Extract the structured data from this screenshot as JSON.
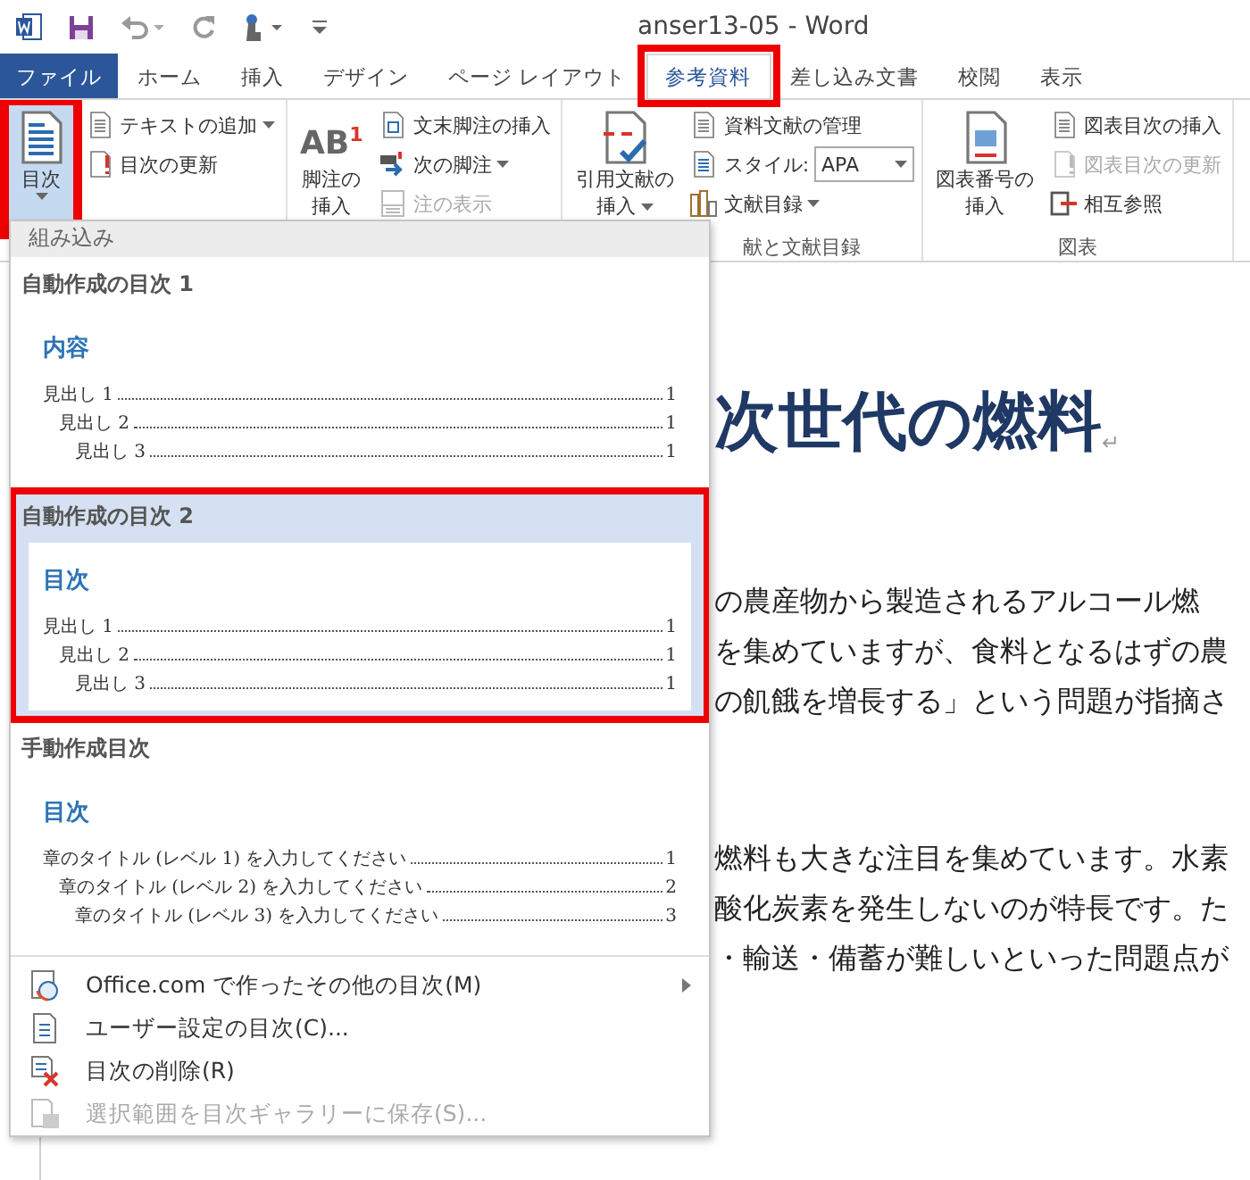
{
  "window": {
    "title": "anser13-05 - Word"
  },
  "tabs": [
    {
      "label": "ファイル",
      "kind": "file",
      "selected": false,
      "highlighted": false
    },
    {
      "label": "ホーム",
      "kind": "tab",
      "selected": false,
      "highlighted": false
    },
    {
      "label": "挿入",
      "kind": "tab",
      "selected": false,
      "highlighted": false
    },
    {
      "label": "デザイン",
      "kind": "tab",
      "selected": false,
      "highlighted": false
    },
    {
      "label": "ページ レイアウト",
      "kind": "tab",
      "selected": false,
      "highlighted": false
    },
    {
      "label": "参考資料",
      "kind": "tab",
      "selected": true,
      "highlighted": true
    },
    {
      "label": "差し込み文書",
      "kind": "tab",
      "selected": false,
      "highlighted": false
    },
    {
      "label": "校閲",
      "kind": "tab",
      "selected": false,
      "highlighted": false
    },
    {
      "label": "表示",
      "kind": "tab",
      "selected": false,
      "highlighted": false
    }
  ],
  "ribbon": {
    "groups": [
      {
        "items": [
          {
            "kind": "large",
            "label_lines": [
              "目次"
            ],
            "dropdown": true,
            "pressed": true,
            "highlighted": true
          },
          {
            "kind": "small",
            "label": "テキストの追加",
            "dropdown": true,
            "disabled": false
          },
          {
            "kind": "small",
            "label": "目次の更新",
            "dropdown": false,
            "disabled": false
          }
        ]
      },
      {
        "items": [
          {
            "kind": "large",
            "glyph": "AB$^{1}$",
            "label_lines": [
              "脚注の",
              "挿入"
            ],
            "dropdown": false,
            "pressed": false,
            "highlighted": false
          },
          {
            "kind": "small",
            "label": "文末脚注の挿入",
            "dropdown": false,
            "disabled": false
          },
          {
            "kind": "small",
            "label": "次の脚注",
            "dropdown": true,
            "disabled": false
          },
          {
            "kind": "small",
            "label": "注の表示",
            "dropdown": false,
            "disabled": true
          }
        ]
      },
      {
        "label": "献と文献目録",
        "items": [
          {
            "kind": "large",
            "label_lines": [
              "引用文献の",
              "挿入"
            ],
            "dropdown": true,
            "pressed": false,
            "highlighted": false
          },
          {
            "kind": "small",
            "label": "資料文献の管理",
            "dropdown": false,
            "disabled": false
          },
          {
            "kind": "combo",
            "label": "スタイル:",
            "value": "APA"
          },
          {
            "kind": "small",
            "label": "文献目録",
            "dropdown": true,
            "disabled": false
          }
        ]
      },
      {
        "label": "図表",
        "items": [
          {
            "kind": "large",
            "label_lines": [
              "図表番号の",
              "挿入"
            ],
            "dropdown": false,
            "pressed": false,
            "highlighted": false
          },
          {
            "kind": "small",
            "label": "図表目次の挿入",
            "dropdown": false,
            "disabled": false
          },
          {
            "kind": "small",
            "label": "図表目次の更新",
            "dropdown": false,
            "disabled": true
          },
          {
            "kind": "small",
            "label": "相互参照",
            "dropdown": false,
            "disabled": false
          }
        ]
      }
    ]
  },
  "document": {
    "heading": "次世代の燃料",
    "paragraph_mark": "↵",
    "paragraphs": [
      [
        "の農産物から製造されるアルコール燃",
        "を集めていますが、食料となるはずの農",
        "の飢餓を増長する」という問題が指摘さ"
      ],
      [
        "燃料も大きな注目を集めています。水素",
        "酸化炭素を発生しないのが特長です。た",
        "・輸送・備蓄が難しいといった問題点が"
      ]
    ]
  },
  "menu": {
    "section": "組み込み",
    "gallery": [
      {
        "label": "自動作成の目次 1",
        "selected": false,
        "highlighted": false,
        "preview": {
          "title": "内容",
          "entries": [
            {
              "text": "見出し 1",
              "page": "1",
              "children": [
                {
                  "text": "見出し 2",
                  "page": "1",
                  "children": [
                    {
                      "text": "見出し 3",
                      "page": "1"
                    }
                  ]
                }
              ]
            }
          ]
        }
      },
      {
        "label": "自動作成の目次 2",
        "selected": true,
        "highlighted": true,
        "preview": {
          "title": "目次",
          "entries": [
            {
              "text": "見出し 1",
              "page": "1",
              "children": [
                {
                  "text": "見出し 2",
                  "page": "1",
                  "children": [
                    {
                      "text": "見出し 3",
                      "page": "1"
                    }
                  ]
                }
              ]
            }
          ]
        }
      },
      {
        "label": "手動作成目次",
        "selected": false,
        "highlighted": false,
        "preview": {
          "title": "目次",
          "entries": [
            {
              "text": "章のタイトル (レベル 1) を入力してください",
              "page": "1",
              "children": [
                {
                  "text": "章のタイトル (レベル 2) を入力してください",
                  "page": "2",
                  "children": [
                    {
                      "text": "章のタイトル (レベル 3) を入力してください",
                      "page": "3"
                    }
                  ]
                }
              ]
            }
          ]
        }
      }
    ],
    "commands": [
      {
        "label": "Office.com で作ったその他の目次(M)",
        "submenu": true,
        "disabled": false
      },
      {
        "label": "ユーザー設定の目次(C)...",
        "submenu": false,
        "disabled": false
      },
      {
        "label": "目次の削除(R)",
        "submenu": false,
        "disabled": false
      },
      {
        "label": "選択範囲を目次ギャラリーに保存(S)...",
        "submenu": false,
        "disabled": true
      }
    ]
  }
}
